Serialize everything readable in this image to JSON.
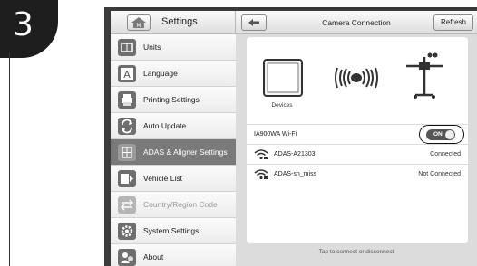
{
  "step": {
    "number": "3"
  },
  "sidebar": {
    "title": "Settings",
    "items": [
      {
        "label": "Units",
        "icon": "units-icon",
        "state": "normal"
      },
      {
        "label": "Language",
        "icon": "language-icon",
        "state": "normal"
      },
      {
        "label": "Printing Settings",
        "icon": "printer-icon",
        "state": "normal"
      },
      {
        "label": "Auto Update",
        "icon": "auto-update-icon",
        "state": "normal"
      },
      {
        "label": "ADAS & Aligner Settings",
        "icon": "adas-icon",
        "state": "active"
      },
      {
        "label": "Vehicle List",
        "icon": "vehicle-list-icon",
        "state": "normal"
      },
      {
        "label": "Country/Region Code",
        "icon": "country-icon",
        "state": "disabled"
      },
      {
        "label": "System Settings",
        "icon": "gear-icon",
        "state": "normal"
      },
      {
        "label": "About",
        "icon": "about-icon",
        "state": "normal"
      }
    ]
  },
  "header": {
    "title": "Camera Connection",
    "refresh_label": "Refresh"
  },
  "devices": {
    "label": "Devices"
  },
  "wifi": {
    "label": "IA900WA Wi-Fi",
    "toggle_label": "ON",
    "networks": [
      {
        "name": "ADAS-A21303",
        "status": "Connected"
      },
      {
        "name": "ADAS-sn_miss",
        "status": "Not Connected"
      }
    ]
  },
  "hint": "Tap to connect or disconnect",
  "colors": {
    "active_item": "#7a7a7a",
    "toggle": "#555555",
    "frame": "#3b3b3b"
  }
}
